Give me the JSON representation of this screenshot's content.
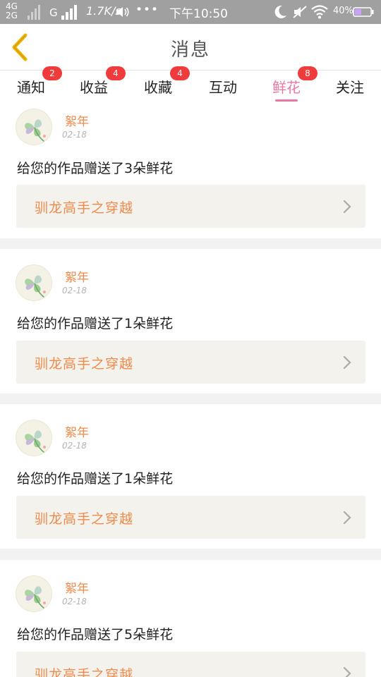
{
  "status_bar": {
    "network_top": "4G",
    "network_bottom": "2G",
    "carrier_g": "G",
    "speed": "1.7K/s",
    "dots": "•••",
    "time": "下午10:50",
    "battery": "40%",
    "icons": [
      "signal-icon",
      "volume-icon",
      "moon-icon",
      "mute-icon",
      "wifi-icon",
      "battery-icon"
    ]
  },
  "header": {
    "title": "消息",
    "back_icon": "chevron-left-icon",
    "back_color": "#f0b400"
  },
  "tabs": [
    {
      "label": "通知",
      "badge": "2",
      "active": false
    },
    {
      "label": "收益",
      "badge": "4",
      "active": false
    },
    {
      "label": "收藏",
      "badge": "4",
      "active": false
    },
    {
      "label": "互动",
      "badge": "",
      "active": false
    },
    {
      "label": "鲜花",
      "badge": "8",
      "active": true
    },
    {
      "label": "关注",
      "badge": "",
      "active": false
    }
  ],
  "messages": [
    {
      "user": "絮年",
      "date": "02-18",
      "text": "给您的作品赠送了3朵鲜花",
      "work": "驯龙高手之穿越"
    },
    {
      "user": "絮年",
      "date": "02-18",
      "text": "给您的作品赠送了1朵鲜花",
      "work": "驯龙高手之穿越"
    },
    {
      "user": "絮年",
      "date": "02-18",
      "text": "给您的作品赠送了1朵鲜花",
      "work": "驯龙高手之穿越"
    },
    {
      "user": "絮年",
      "date": "02-18",
      "text": "给您的作品赠送了5朵鲜花",
      "work": "驯龙高手之穿越"
    }
  ],
  "colors": {
    "accent": "#e977a6",
    "username": "#ef8a4b",
    "badge": "#ef3b3b",
    "link_bg": "#f3f2ec"
  }
}
